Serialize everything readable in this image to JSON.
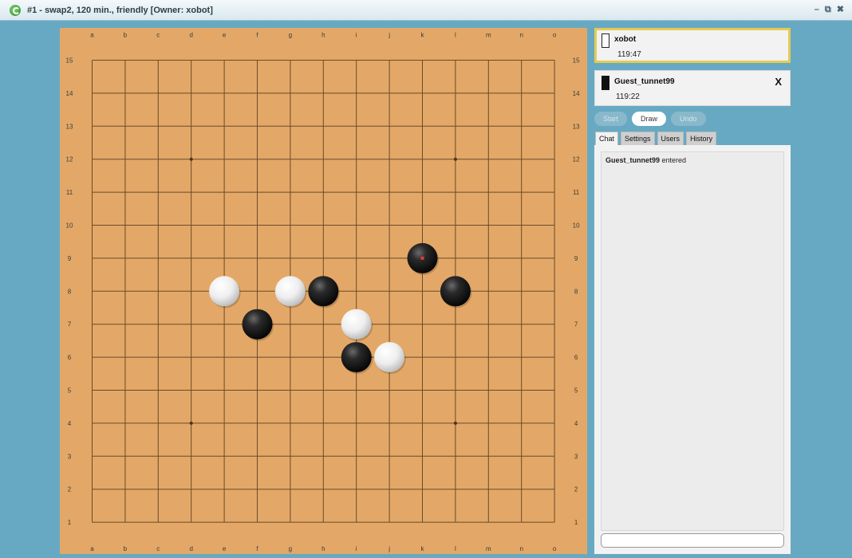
{
  "window": {
    "title": "#1 - swap2, 120 min., friendly [Owner: xobot]",
    "controls": [
      "–",
      "⧉",
      "✖"
    ]
  },
  "board": {
    "size": 15,
    "columns": [
      "a",
      "b",
      "c",
      "d",
      "e",
      "f",
      "g",
      "h",
      "i",
      "j",
      "k",
      "l",
      "m",
      "n",
      "o"
    ],
    "rows": [
      "15",
      "14",
      "13",
      "12",
      "11",
      "10",
      "9",
      "8",
      "7",
      "6",
      "5",
      "4",
      "3",
      "2",
      "1"
    ],
    "star_points": [
      "d12",
      "l12",
      "d4",
      "l4"
    ],
    "stones": [
      {
        "color": "black",
        "pos": "k9",
        "last_move": true
      },
      {
        "color": "white",
        "pos": "e8"
      },
      {
        "color": "white",
        "pos": "g8"
      },
      {
        "color": "black",
        "pos": "h8"
      },
      {
        "color": "black",
        "pos": "l8"
      },
      {
        "color": "black",
        "pos": "f7"
      },
      {
        "color": "white",
        "pos": "i7"
      },
      {
        "color": "black",
        "pos": "i6"
      },
      {
        "color": "white",
        "pos": "j6"
      }
    ],
    "colors": {
      "board": "#e3a867",
      "line": "#6b4a2b",
      "last_move_marker": "#e23b2e"
    }
  },
  "players": [
    {
      "name": "xobot",
      "time": "119:47",
      "stone": "white",
      "active": true
    },
    {
      "name": "Guest_tunnet99",
      "time": "119:22",
      "stone": "black",
      "active": false,
      "close_label": "X"
    }
  ],
  "actions": {
    "start": "Start",
    "draw": "Draw",
    "undo": "Undo"
  },
  "tabs": [
    "Chat",
    "Settings",
    "Users",
    "History"
  ],
  "chat": {
    "messages": [
      {
        "user": "Guest_tunnet99",
        "text": "entered"
      }
    ],
    "input_value": ""
  }
}
